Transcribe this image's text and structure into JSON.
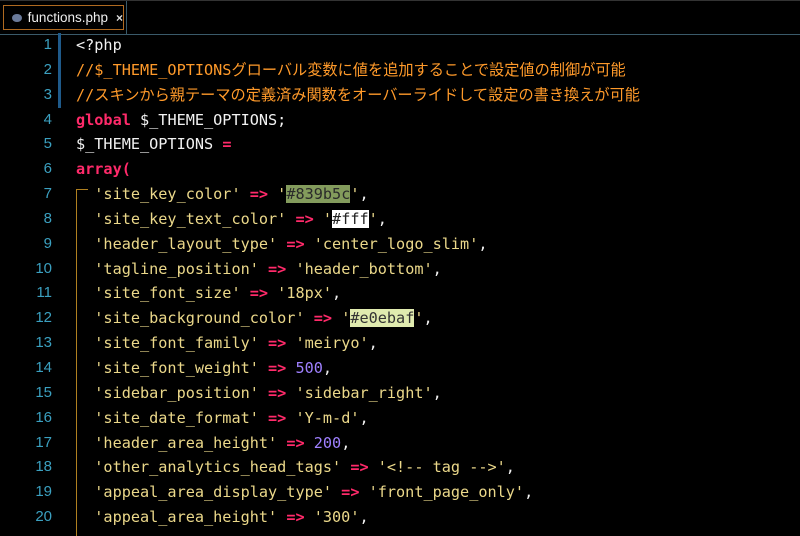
{
  "tab": {
    "title": "functions.php",
    "close": "×",
    "icon": "php-file-icon"
  },
  "colors": {
    "site_key_color": "#839b5c",
    "site_key_text_color": "#fff",
    "site_background_color": "#e0ebaf"
  },
  "lines": [
    {
      "n": "1",
      "m": true,
      "tokens": [
        {
          "t": "<?php",
          "c": "plain"
        }
      ]
    },
    {
      "n": "2",
      "m": true,
      "tokens": [
        {
          "t": "//$_THEME_OPTIONSグローバル変数に値を追加することで設定値の制御が可能",
          "c": "cm"
        }
      ]
    },
    {
      "n": "3",
      "m": true,
      "tokens": [
        {
          "t": "//スキンから親テーマの定義済み関数をオーバーライドして設定の書き換えが可能",
          "c": "cm"
        }
      ]
    },
    {
      "n": "4",
      "tokens": [
        {
          "t": "global",
          "c": "kw"
        },
        {
          "t": " $_THEME_OPTIONS;",
          "c": "plain"
        }
      ]
    },
    {
      "n": "5",
      "tokens": [
        {
          "t": "$_THEME_OPTIONS ",
          "c": "plain"
        },
        {
          "t": "=",
          "c": "op"
        }
      ]
    },
    {
      "n": "6",
      "tokens": [
        {
          "t": "array(",
          "c": "kw"
        }
      ]
    },
    {
      "n": "7",
      "tokens": [
        {
          "t": "  'site_key_color' ",
          "c": "str"
        },
        {
          "t": "=>",
          "c": "op"
        },
        {
          "t": " '",
          "c": "str"
        },
        {
          "t": "#839b5c",
          "c": "hl1"
        },
        {
          "t": "'",
          "c": "str"
        },
        {
          "t": ",",
          "c": "plain"
        }
      ]
    },
    {
      "n": "8",
      "tokens": [
        {
          "t": "  'site_key_text_color' ",
          "c": "str"
        },
        {
          "t": "=>",
          "c": "op"
        },
        {
          "t": " '",
          "c": "str"
        },
        {
          "t": "#fff",
          "c": "hl2"
        },
        {
          "t": "'",
          "c": "str"
        },
        {
          "t": ",",
          "c": "plain"
        }
      ]
    },
    {
      "n": "9",
      "tokens": [
        {
          "t": "  'header_layout_type' ",
          "c": "str"
        },
        {
          "t": "=>",
          "c": "op"
        },
        {
          "t": " 'center_logo_slim'",
          "c": "str"
        },
        {
          "t": ",",
          "c": "plain"
        }
      ]
    },
    {
      "n": "10",
      "tokens": [
        {
          "t": "  'tagline_position' ",
          "c": "str"
        },
        {
          "t": "=>",
          "c": "op"
        },
        {
          "t": " 'header_bottom'",
          "c": "str"
        },
        {
          "t": ",",
          "c": "plain"
        }
      ]
    },
    {
      "n": "11",
      "tokens": [
        {
          "t": "  'site_font_size' ",
          "c": "str"
        },
        {
          "t": "=>",
          "c": "op"
        },
        {
          "t": " '18px'",
          "c": "str"
        },
        {
          "t": ",",
          "c": "plain"
        }
      ]
    },
    {
      "n": "12",
      "tokens": [
        {
          "t": "  'site_background_color' ",
          "c": "str"
        },
        {
          "t": "=>",
          "c": "op"
        },
        {
          "t": " '",
          "c": "str"
        },
        {
          "t": "#e0ebaf",
          "c": "hl3"
        },
        {
          "t": "'",
          "c": "str"
        },
        {
          "t": ",",
          "c": "plain"
        }
      ]
    },
    {
      "n": "13",
      "tokens": [
        {
          "t": "  'site_font_family' ",
          "c": "str"
        },
        {
          "t": "=>",
          "c": "op"
        },
        {
          "t": " 'meiryo'",
          "c": "str"
        },
        {
          "t": ",",
          "c": "plain"
        }
      ]
    },
    {
      "n": "14",
      "tokens": [
        {
          "t": "  'site_font_weight' ",
          "c": "str"
        },
        {
          "t": "=>",
          "c": "op"
        },
        {
          "t": " ",
          "c": "plain"
        },
        {
          "t": "500",
          "c": "num"
        },
        {
          "t": ",",
          "c": "plain"
        }
      ]
    },
    {
      "n": "15",
      "tokens": [
        {
          "t": "  'sidebar_position' ",
          "c": "str"
        },
        {
          "t": "=>",
          "c": "op"
        },
        {
          "t": " 'sidebar_right'",
          "c": "str"
        },
        {
          "t": ",",
          "c": "plain"
        }
      ]
    },
    {
      "n": "16",
      "tokens": [
        {
          "t": "  'site_date_format' ",
          "c": "str"
        },
        {
          "t": "=>",
          "c": "op"
        },
        {
          "t": " 'Y-m-d'",
          "c": "str"
        },
        {
          "t": ",",
          "c": "plain"
        }
      ]
    },
    {
      "n": "17",
      "tokens": [
        {
          "t": "  'header_area_height' ",
          "c": "str"
        },
        {
          "t": "=>",
          "c": "op"
        },
        {
          "t": " ",
          "c": "plain"
        },
        {
          "t": "200",
          "c": "num"
        },
        {
          "t": ",",
          "c": "plain"
        }
      ]
    },
    {
      "n": "18",
      "tokens": [
        {
          "t": "  'other_analytics_head_tags' ",
          "c": "str"
        },
        {
          "t": "=>",
          "c": "op"
        },
        {
          "t": " '<!-- tag -->'",
          "c": "str"
        },
        {
          "t": ",",
          "c": "plain"
        }
      ]
    },
    {
      "n": "19",
      "tokens": [
        {
          "t": "  'appeal_area_display_type' ",
          "c": "str"
        },
        {
          "t": "=>",
          "c": "op"
        },
        {
          "t": " 'front_page_only'",
          "c": "str"
        },
        {
          "t": ",",
          "c": "plain"
        }
      ]
    },
    {
      "n": "20",
      "tokens": [
        {
          "t": "  'appeal_area_height' ",
          "c": "str"
        },
        {
          "t": "=>",
          "c": "op"
        },
        {
          "t": " '300'",
          "c": "str"
        },
        {
          "t": ",",
          "c": "plain"
        }
      ]
    }
  ]
}
